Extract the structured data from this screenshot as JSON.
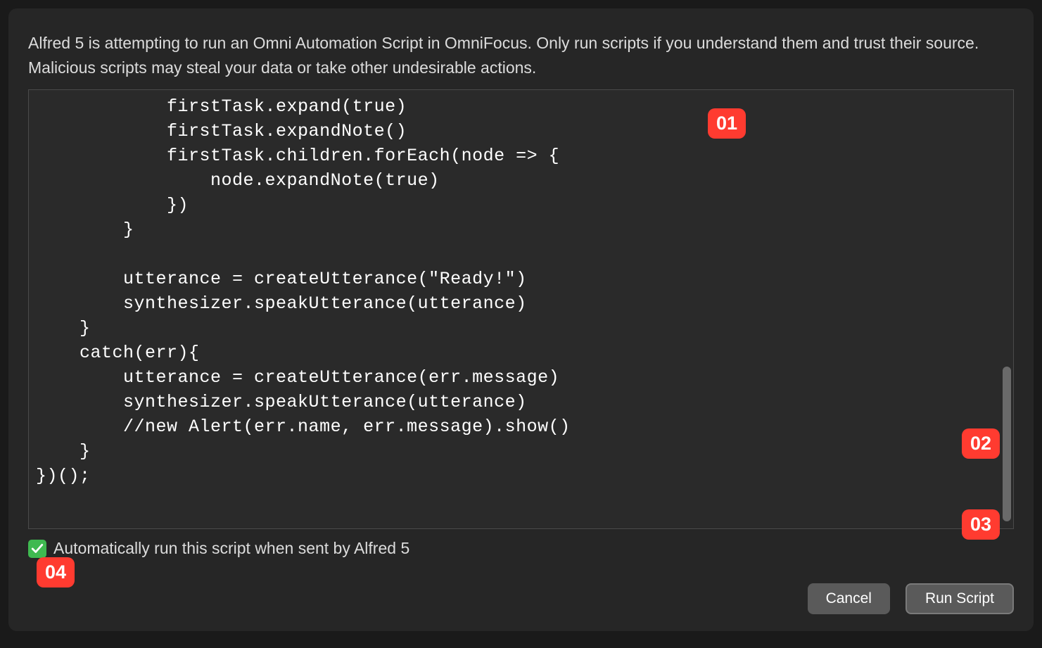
{
  "dialog": {
    "warning_text": "Alfred 5 is attempting to run an Omni Automation Script in OmniFocus. Only run scripts if you understand them and trust their source. Malicious scripts may steal your data or take other undesirable actions.",
    "script_code": "            firstTask.expand(true)\n            firstTask.expandNote()\n            firstTask.children.forEach(node => {\n                node.expandNote(true)\n            })\n        }\n\n        utterance = createUtterance(\"Ready!\")\n        synthesizer.speakUtterance(utterance)\n    }\n    catch(err){\n        utterance = createUtterance(err.message)\n        synthesizer.speakUtterance(utterance)\n        //new Alert(err.name, err.message).show()\n    }\n})();",
    "checkbox_label": "Automatically run this script when sent by Alfred 5",
    "checkbox_checked": true,
    "cancel_label": "Cancel",
    "run_label": "Run Script"
  },
  "badges": {
    "b01": "01",
    "b02": "02",
    "b03": "03",
    "b04": "04"
  }
}
